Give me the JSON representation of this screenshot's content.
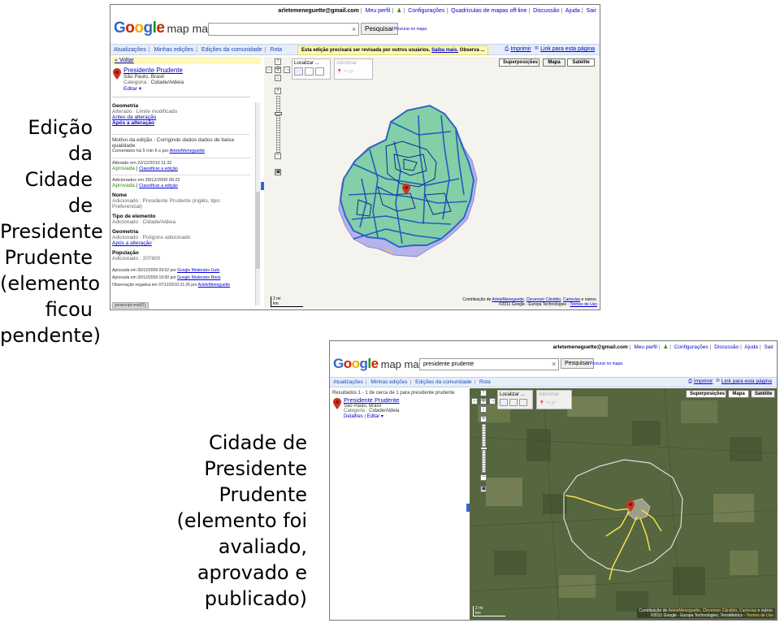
{
  "captions": {
    "first": [
      "Edição da",
      "Cidade de",
      "Presidente",
      "Prudente",
      "(elemento",
      "ficou",
      "pendente)"
    ],
    "second": [
      "Cidade de",
      "Presidente",
      "Prudente",
      "(elemento foi",
      "avaliado,",
      "aprovado e",
      "publicado)"
    ]
  },
  "header": {
    "email": "arletemeneguette@gmail.com",
    "links": [
      "Meu perfil",
      "Configurações",
      "Quadrículas de mapas off-line",
      "Discussão",
      "Ajuda",
      "Sair"
    ],
    "logo_google": "Google",
    "logo_product": "map maker",
    "search_button": "Pesquisar",
    "nearby_link": "Procurar no mapa",
    "clear_icon": "×"
  },
  "shot1": {
    "search_value": "",
    "nav": [
      "Atualizações",
      "Minhas edições",
      "Edições da comunidade",
      "Rota"
    ],
    "notice_text": "Esta edição precisará ser revisada por outros usuários.",
    "notice_link": "Saiba mais.",
    "notice_tail": "Observa ...",
    "print_link": "Imprimir",
    "link_page": "Link para esta página",
    "back_link": "« Voltar",
    "place_name": "Presidente Prudente",
    "place_region": "São Paulo, Brasil",
    "category_label": "Categoria :",
    "category_value": "Cidade/Aldeia",
    "edit_link": "Editar ▾",
    "geometria_hd": "Geometria",
    "geometria_altered": "Alterado : Limite modificado",
    "antes_link": "Antes da alteração",
    "apos_link": "Após a alteração",
    "motivo": "Motivo da edição : Corrigindo dados dados de baixa qualidade",
    "comentario_prefix": "Comentário há 5 min 6 s por",
    "author": "ArleteMeneguette",
    "alterado_em": "Alterado em 22/12/2010 11:32",
    "aprovada": "Aprovada",
    "classificar": "Classificar a edição",
    "adicionados_em": "Adicionados em 30/12/2009 09:22",
    "nome_hd": "Nome",
    "nome_value": "Adicionado : Presidente Prudente (inglês, tipo: Preferencial)",
    "tipo_hd": "Tipo de elemento",
    "tipo_value": "Adicionado : Cidade/Aldeia",
    "geom2_hd": "Geometria",
    "geom2_value": "Adicionado : Polígono adicionado",
    "pop_hd": "População",
    "pop_value": "Adicionado : 207800",
    "log1_prefix": "Aprovada em 30/12/2009 09:52 por",
    "log1_author": "Google Moderator Guts",
    "log2_prefix": "Aprovada em 30/12/2009 10:00 por",
    "log2_author": "Google Moderator Rteia",
    "log3_prefix": "Observação negativa em 07/12/2010 21:26 por",
    "status_bar": "javascript:void(0);",
    "localizar": "Localizar ...",
    "adicionar": "Adicionar",
    "overlays_btn": "Superposições",
    "mapa_btn": "Mapa",
    "satelite_btn": "Satélite",
    "scale_mi": "2 mi",
    "scale_km": "km",
    "contrib_prefix": "Contribuição de",
    "contributors": [
      "ArleteMeneguette",
      "Cleverson Cândido",
      "Cartovias"
    ],
    "contrib_suffix": "e outros.",
    "copyright": "©2011 Google - Europa Technologies -",
    "terms": "Termos de Uso"
  },
  "shot2": {
    "search_value": "presidente prudente",
    "nav": [
      "Atualizações",
      "Minhas edições",
      "Edições da comunidade",
      "Rota"
    ],
    "print_link": "Imprimir",
    "link_page": "Link para esta página",
    "results": "Resultados 1 - 1 de cerca de 1 para presidente prudente",
    "place_name": "Presidente Prudente",
    "place_region": "São Paulo, Brasil",
    "category_label": "Categoria :",
    "category_value": "Cidade/Aldeia",
    "details_link": "Detalhes",
    "edit_link": "Editar ▾",
    "localizar": "Localizar ...",
    "adicionar": "Adicionar",
    "overlays_btn": "Superposições",
    "mapa_btn": "Mapa",
    "satelite_btn": "Satélite",
    "scale_mi": "2 mi",
    "scale_km": "km",
    "contrib_prefix": "Contribuição de",
    "contributors": [
      "ArleteMeneguette",
      "Cleverson Cândido",
      "Cartovias"
    ],
    "contrib_suffix": "e outros.",
    "copyright": "©2011 Google - Europa Technologies, TerraMetrics -",
    "terms": "Termos de Uso"
  },
  "colors": {
    "nav_bg": "#e6eef9",
    "notice_bg": "#fff8b6",
    "polygon_fill": "#7fd3a0",
    "polygon_stroke": "#1f5fbf",
    "satellite": "#4a5a3a",
    "boundary": "#dddddd",
    "roads": "#f2e14a"
  },
  "icons": [
    "search-icon",
    "clear-icon",
    "pin-icon",
    "pan-icon",
    "zoom-in-icon",
    "zoom-out-icon",
    "print-icon",
    "link-icon"
  ]
}
